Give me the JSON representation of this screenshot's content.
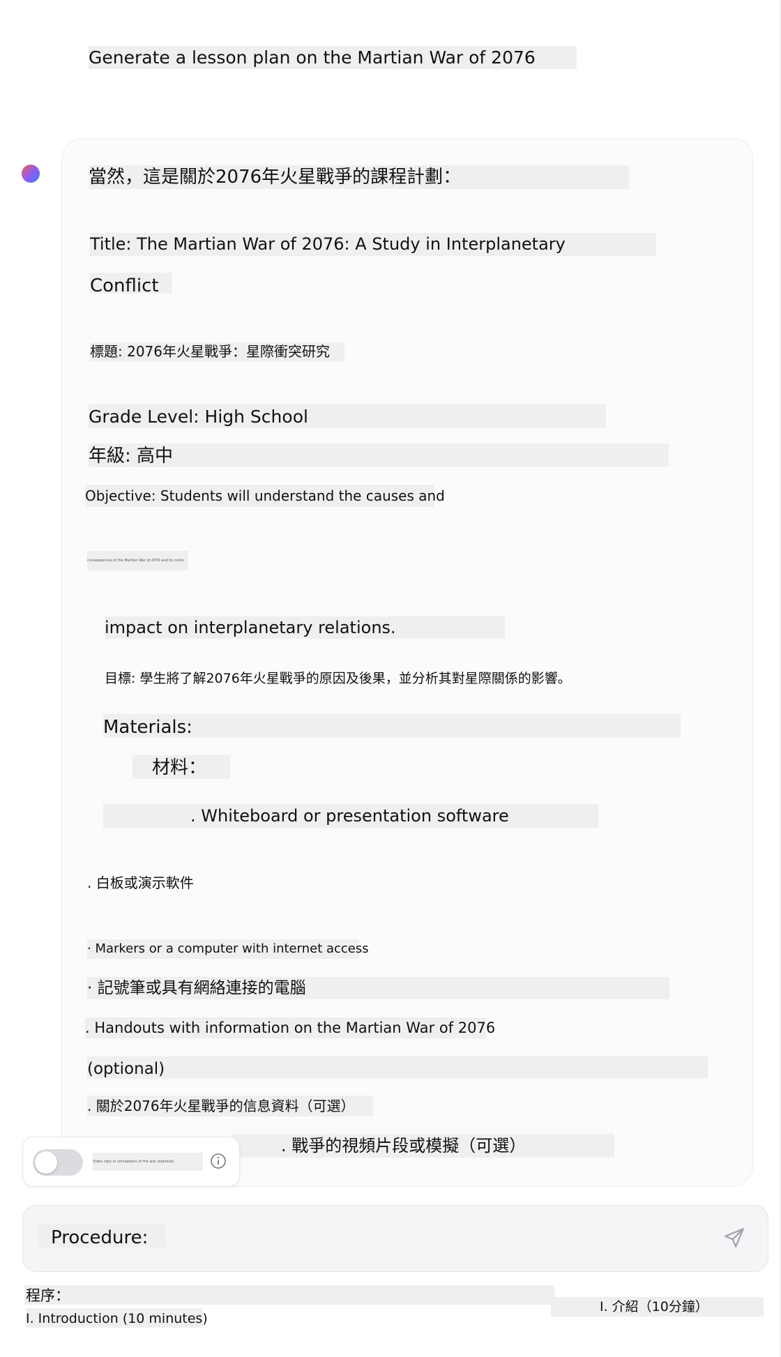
{
  "user_message": "Generate a lesson plan on the Martian War of 2076",
  "response": {
    "intro": "當然，這是關於2076年火星戰爭的課程計劃：",
    "title_line1": "Title: The Martian War of 2076: A Study in Interplanetary",
    "title_line2": "Conflict",
    "title_zh": "標題: 2076年火星戰爭：星際衝突研究",
    "grade_en": "Grade Level: High School",
    "grade_zh": "年級: 高中",
    "objective_line1": "Objective: Students will understand the causes and",
    "objective_line2_tiny": "consequences of the Martian War of 2076 and its conte",
    "objective_line3": "impact on interplanetary relations.",
    "objective_zh": "目標: 學生將了解2076年火星戰爭的原因及後果，並分析其對星際關係的影響。",
    "materials_en": "Materials:",
    "materials_zh": "材料：",
    "item1_en": ". Whiteboard or presentation software",
    "item1_zh": ". 白板或演示軟件",
    "item2_en": "· Markers or a computer with internet access",
    "item2_zh": "· 記號筆或具有網絡連接的電腦",
    "item3_en": ". Handouts with information on the Martian War of 2076",
    "item3_en_cont": "(optional)",
    "item3_zh": ". 關於2076年火星戰爭的信息資料（可選）",
    "item4_zh": ". 戰爭的視頻片段或模擬（可選）"
  },
  "toggle": {
    "label_tiny": "Video clips or simulations of the war (optional)"
  },
  "input": {
    "value": "Procedure:"
  },
  "below": {
    "procedure_zh": "程序：",
    "intro_en": "I. Introduction (10 minutes)",
    "intro_zh": "I. 介紹（10分鐘）"
  }
}
